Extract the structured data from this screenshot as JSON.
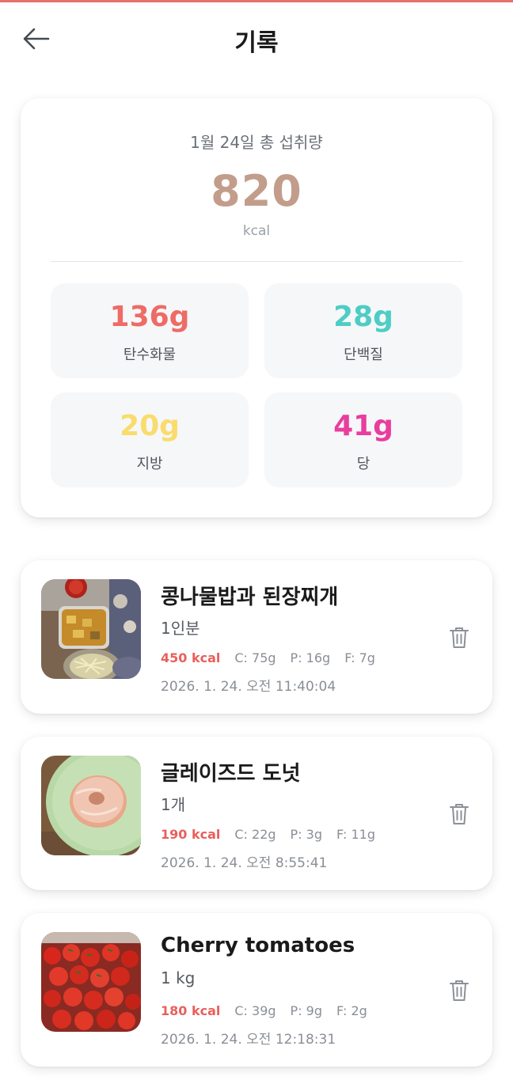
{
  "header": {
    "title": "기록"
  },
  "summary": {
    "date_label": "1월 24일 총 섭취량",
    "total_kcal": "820",
    "unit": "kcal",
    "macros": [
      {
        "value": "136g",
        "label": "탄수화물",
        "color": "#ee6b66"
      },
      {
        "value": "28g",
        "label": "단백질",
        "color": "#4ecdc4"
      },
      {
        "value": "20g",
        "label": "지방",
        "color": "#f9dc6b"
      },
      {
        "value": "41g",
        "label": "당",
        "color": "#e83e9e"
      }
    ]
  },
  "entries": [
    {
      "name": "콩나물밥과 된장찌개",
      "quantity": "1인분",
      "kcal": "450 kcal",
      "carbs": "C: 75g",
      "protein": "P: 16g",
      "fat": "F: 7g",
      "time": "2026. 1. 24. 오전 11:40:04"
    },
    {
      "name": "글레이즈드 도넛",
      "quantity": "1개",
      "kcal": "190 kcal",
      "carbs": "C: 22g",
      "protein": "P: 3g",
      "fat": "F: 11g",
      "time": "2026. 1. 24. 오전 8:55:41"
    },
    {
      "name": "Cherry tomatoes",
      "quantity": "1 kg",
      "kcal": "180 kcal",
      "carbs": "C: 39g",
      "protein": "P: 9g",
      "fat": "F: 2g",
      "time": "2026. 1. 24. 오전 12:18:31"
    }
  ],
  "icons": {
    "back": "arrow-left-icon",
    "delete": "trash-icon"
  },
  "colors": {
    "accent": "#e8605c",
    "kcal_total": "#c39d8b",
    "top_bar": "#e7706e"
  }
}
